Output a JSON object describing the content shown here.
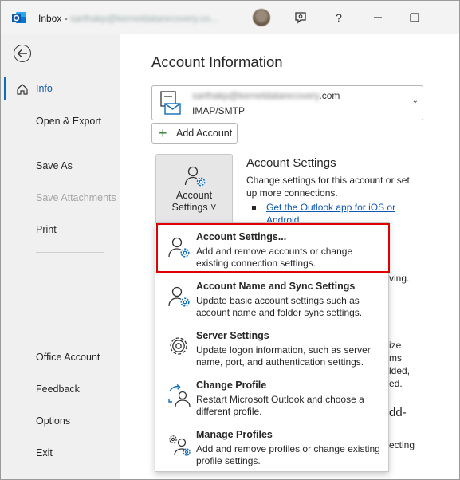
{
  "window": {
    "app_name": "Inbox",
    "separator": " - ",
    "account_email_blurred": "sarthakp@kerneldatarecovery.co..."
  },
  "titlebar_icons": {
    "app": "outlook-icon",
    "feedback": "feedback-icon",
    "help": "?",
    "minimize": "minimize-icon",
    "maximize": "maximize-icon"
  },
  "sidebar": {
    "items": [
      {
        "label": "Info",
        "selected": true
      },
      {
        "label": "Open & Export"
      },
      {
        "label": "Save As"
      },
      {
        "label": "Save Attachments",
        "disabled": true
      },
      {
        "label": "Print"
      },
      {
        "label": "Office Account"
      },
      {
        "label": "Feedback"
      },
      {
        "label": "Options"
      },
      {
        "label": "Exit"
      }
    ]
  },
  "main": {
    "heading": "Account Information",
    "account_selector": {
      "email_blurred": "sarthakp@kerneldatarecovery",
      "email_suffix": ".com",
      "type": "IMAP/SMTP"
    },
    "add_account_label": "Add Account",
    "account_settings_button": {
      "line1": "Account",
      "line2": "Settings ˅"
    },
    "section_title": "Account Settings",
    "section_desc": "Change settings for this account or set up more connections.",
    "ios_link": "Get the Outlook app for iOS or Android.",
    "peek": {
      "p1": "ving.",
      "p2": "ize",
      "p3": "ms",
      "p4": "lded,",
      "p5": "ed.",
      "p6": "dd-",
      "p7": "ecting"
    }
  },
  "dropdown": {
    "items": [
      {
        "title": "Account Settings...",
        "desc": "Add and remove accounts or change existing connection settings.",
        "highlighted": true
      },
      {
        "title": "Account Name and Sync Settings",
        "desc": "Update basic account settings such as account name and folder sync settings."
      },
      {
        "title": "Server Settings",
        "desc": "Update logon information, such as server name, port, and authentication settings."
      },
      {
        "title": "Change Profile",
        "desc": "Restart Microsoft Outlook and choose a different profile."
      },
      {
        "title": "Manage Profiles",
        "desc": "Add and remove profiles or change existing profile settings."
      }
    ]
  },
  "colors": {
    "accent": "#0f6cbd",
    "highlight_border": "#e00000",
    "sidebar_bg": "#f0f0f0",
    "link": "#0f58b0"
  }
}
